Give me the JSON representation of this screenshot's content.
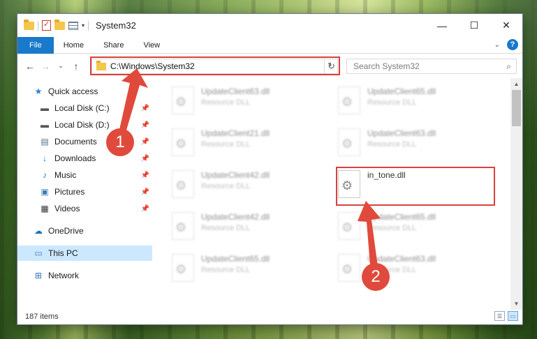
{
  "window": {
    "title": "System32",
    "controls": {
      "minimize": "—",
      "maximize": "☐",
      "close": "✕"
    }
  },
  "ribbon": {
    "tabs": [
      "File",
      "Home",
      "Share",
      "View"
    ],
    "help": "?"
  },
  "address_bar": {
    "path": "C:\\Windows\\System32",
    "search_placeholder": "Search System32"
  },
  "sidebar": {
    "items": [
      {
        "label": "Quick access",
        "icon": "star-icon",
        "pinned": false,
        "selected": false
      },
      {
        "label": "Local Disk (C:)",
        "icon": "drive-icon",
        "pinned": true,
        "selected": false
      },
      {
        "label": "Local Disk (D:)",
        "icon": "drive-icon",
        "pinned": true,
        "selected": false
      },
      {
        "label": "Documents",
        "icon": "documents-icon",
        "pinned": true,
        "selected": false
      },
      {
        "label": "Downloads",
        "icon": "download-arrow-icon",
        "pinned": true,
        "selected": false
      },
      {
        "label": "Music",
        "icon": "music-note-icon",
        "pinned": true,
        "selected": false
      },
      {
        "label": "Pictures",
        "icon": "pictures-icon",
        "pinned": true,
        "selected": false
      },
      {
        "label": "Videos",
        "icon": "film-icon",
        "pinned": true,
        "selected": false
      },
      {
        "label": "OneDrive",
        "icon": "cloud-icon",
        "pinned": false,
        "selected": false
      },
      {
        "label": "This PC",
        "icon": "computer-icon",
        "pinned": false,
        "selected": true
      },
      {
        "label": "Network",
        "icon": "network-icon",
        "pinned": false,
        "selected": false
      }
    ]
  },
  "files": [
    {
      "name": "UpdateClient63.dll",
      "type": "Resource DLL",
      "blurred": true
    },
    {
      "name": "UpdateClient65.dll",
      "type": "Resource DLL",
      "blurred": true
    },
    {
      "name": "UpdateClient21.dll",
      "type": "Resource DLL",
      "blurred": true
    },
    {
      "name": "UpdateClient63.dll",
      "type": "Resource DLL",
      "blurred": true
    },
    {
      "name": "UpdateClient42.dll",
      "type": "Resource DLL",
      "blurred": true
    },
    {
      "name": "in_tone.dll",
      "type": "",
      "blurred": false
    },
    {
      "name": "UpdateClient42.dll",
      "type": "Resource DLL",
      "blurred": true
    },
    {
      "name": "UpdateClient65.dll",
      "type": "Resource DLL",
      "blurred": true
    },
    {
      "name": "UpdateClient65.dll",
      "type": "Resource DLL",
      "blurred": true
    },
    {
      "name": "UpdateClient63.dll",
      "type": "Resource DLL",
      "blurred": true
    }
  ],
  "statusbar": {
    "item_count": "187 items"
  },
  "annotations": {
    "step1": "1",
    "step2": "2",
    "color": "#e04a3c"
  }
}
